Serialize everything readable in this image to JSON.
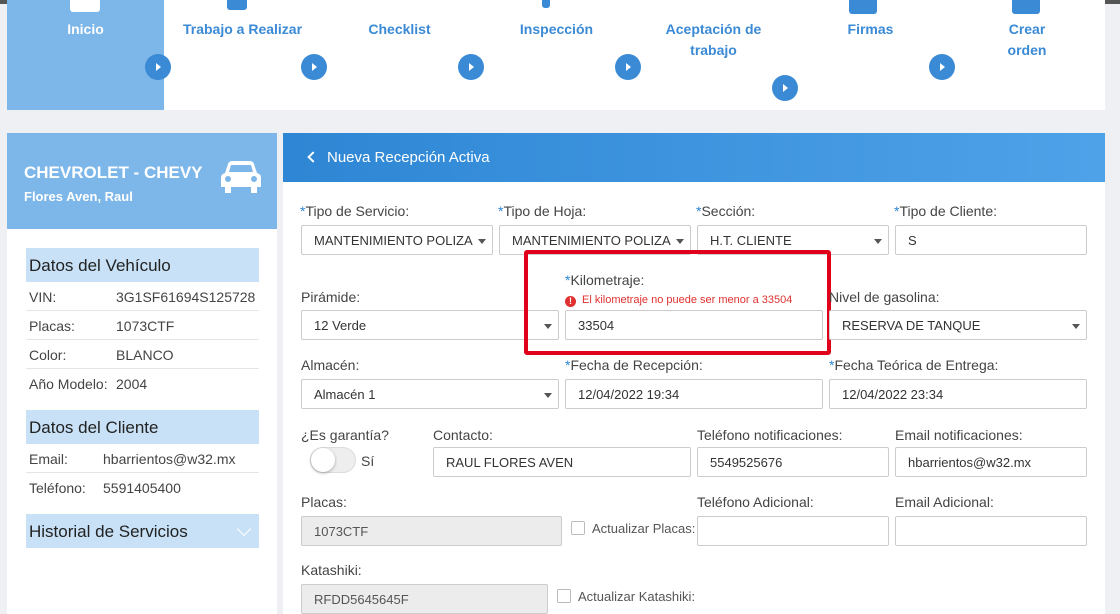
{
  "stepper": {
    "steps": [
      {
        "label": "Inicio"
      },
      {
        "label": "Trabajo a Realizar"
      },
      {
        "label": "Checklist"
      },
      {
        "label": "Inspección"
      },
      {
        "label": "Aceptación de trabajo"
      },
      {
        "label": "Firmas"
      },
      {
        "label": "Crear orden"
      }
    ]
  },
  "vehicle": {
    "title": "CHEVROLET - CHEVY",
    "owner": "Flores Aven, Raul"
  },
  "vehicle_data": {
    "heading": "Datos del Vehículo",
    "rows": [
      {
        "key": "VIN:",
        "value": "3G1SF61694S125728"
      },
      {
        "key": "Placas:",
        "value": "1073CTF"
      },
      {
        "key": "Color:",
        "value": "BLANCO"
      },
      {
        "key": "Año Modelo:",
        "value": "2004"
      }
    ]
  },
  "client_data": {
    "heading": "Datos del Cliente",
    "rows": [
      {
        "key": "Email:",
        "value": "hbarrientos@w32.mx"
      },
      {
        "key": "Teléfono:",
        "value": "5591405400"
      }
    ]
  },
  "history": {
    "heading": "Historial de Servicios"
  },
  "form": {
    "title": "Nueva Recepción Activa",
    "tipo_servicio": {
      "label": "Tipo de Servicio:",
      "value": "MANTENIMIENTO POLIZA"
    },
    "tipo_hoja": {
      "label": "Tipo de Hoja:",
      "value": "MANTENIMIENTO POLIZA"
    },
    "seccion": {
      "label": "Sección:",
      "value": "H.T. CLIENTE"
    },
    "tipo_cliente": {
      "label": "Tipo de Cliente:",
      "value": "S"
    },
    "piramide": {
      "label": "Pirámide:",
      "value": "12 Verde"
    },
    "kilometraje": {
      "label": "Kilometraje:",
      "value": "33504",
      "error": "El kilometraje no puede ser menor a 33504"
    },
    "nivel_gasolina": {
      "label": "Nivel de gasolina:",
      "value": "RESERVA DE TANQUE"
    },
    "almacen": {
      "label": "Almacén:",
      "value": "Almacén 1"
    },
    "fecha_recepcion": {
      "label": "Fecha de Recepción:",
      "value": "12/04/2022 19:34"
    },
    "fecha_entrega": {
      "label": "Fecha Teórica de Entrega:",
      "value": "12/04/2022 23:34"
    },
    "garantia": {
      "label": "¿Es garantía?",
      "toggle_text": "Sí"
    },
    "contacto": {
      "label": "Contacto:",
      "value": "RAUL FLORES AVEN"
    },
    "tel_notif": {
      "label": "Teléfono notificaciones:",
      "value": "5549525676"
    },
    "email_notif": {
      "label": "Email notificaciones:",
      "value": "hbarrientos@w32.mx"
    },
    "placas": {
      "label": "Placas:",
      "value": "1073CTF",
      "update_label": "Actualizar Placas:"
    },
    "tel_adicional": {
      "label": "Teléfono Adicional:",
      "value": ""
    },
    "email_adicional": {
      "label": "Email Adicional:",
      "value": ""
    },
    "katashiki": {
      "label": "Katashiki:",
      "value": "RFDD5645645F",
      "update_label": "Actualizar Katashiki:"
    },
    "required_mark": "*"
  },
  "colors": {
    "accent": "#2e86d4",
    "active_step": "#7db6e8",
    "error": "#e03030",
    "highlight": "#e0001b"
  }
}
